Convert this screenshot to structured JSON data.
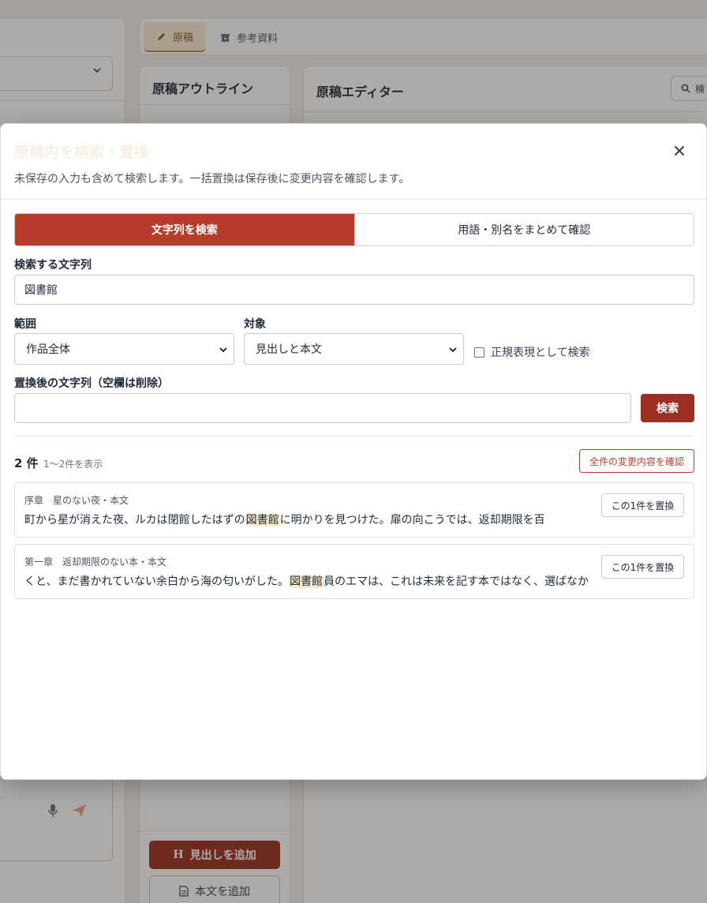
{
  "app": {
    "tabs": [
      {
        "label": "原稿",
        "icon": "pen-icon",
        "active": true
      },
      {
        "label": "参考資料",
        "icon": "archive-icon",
        "active": false
      }
    ],
    "outline": {
      "title": "原稿アウトライン",
      "add_heading_label": "見出しを追加",
      "add_body_label": "本文を追加"
    },
    "editor": {
      "title": "原稿エディター",
      "search_label": "検"
    }
  },
  "modal": {
    "title": "原稿内を検索・置換",
    "description": "未保存の入力も含めて検索します。一括置換は保存後に変更内容を確認します。",
    "modes": [
      {
        "label": "文字列を検索",
        "active": true
      },
      {
        "label": "用語・別名をまとめて確認",
        "active": false
      }
    ],
    "search_label": "検索する文字列",
    "search_value": "図書館",
    "range_label": "範囲",
    "range_value": "作品全体",
    "target_label": "対象",
    "target_value": "見出しと本文",
    "regex_label": "正規表現として検索",
    "regex_checked": false,
    "replace_label": "置換後の文字列（空欄は削除）",
    "replace_value": "",
    "search_button": "検索",
    "result_count": "2 件",
    "result_range": "1〜2件を表示",
    "confirm_all_button": "全件の変更内容を確認",
    "results": [
      {
        "meta": "序章　星のない夜・本文",
        "before": "町から星が消えた夜、ルカは閉館したはずの",
        "match": "図書館",
        "after": "に明かりを見つけた。扉の向こうでは、返却期限を百",
        "button": "この1件を置換"
      },
      {
        "meta": "第一章　返却期限のない本・本文",
        "before": "くと、まだ書かれていない余白から海の匂いがした。",
        "match": "図書館",
        "after": "員のエマは、これは未来を記す本ではなく、選ばなか",
        "button": "この1件を置換"
      }
    ]
  },
  "colors": {
    "accent": "#b83c2b",
    "accent_dark": "#9c2f23",
    "highlight": "#f8e9cd"
  }
}
